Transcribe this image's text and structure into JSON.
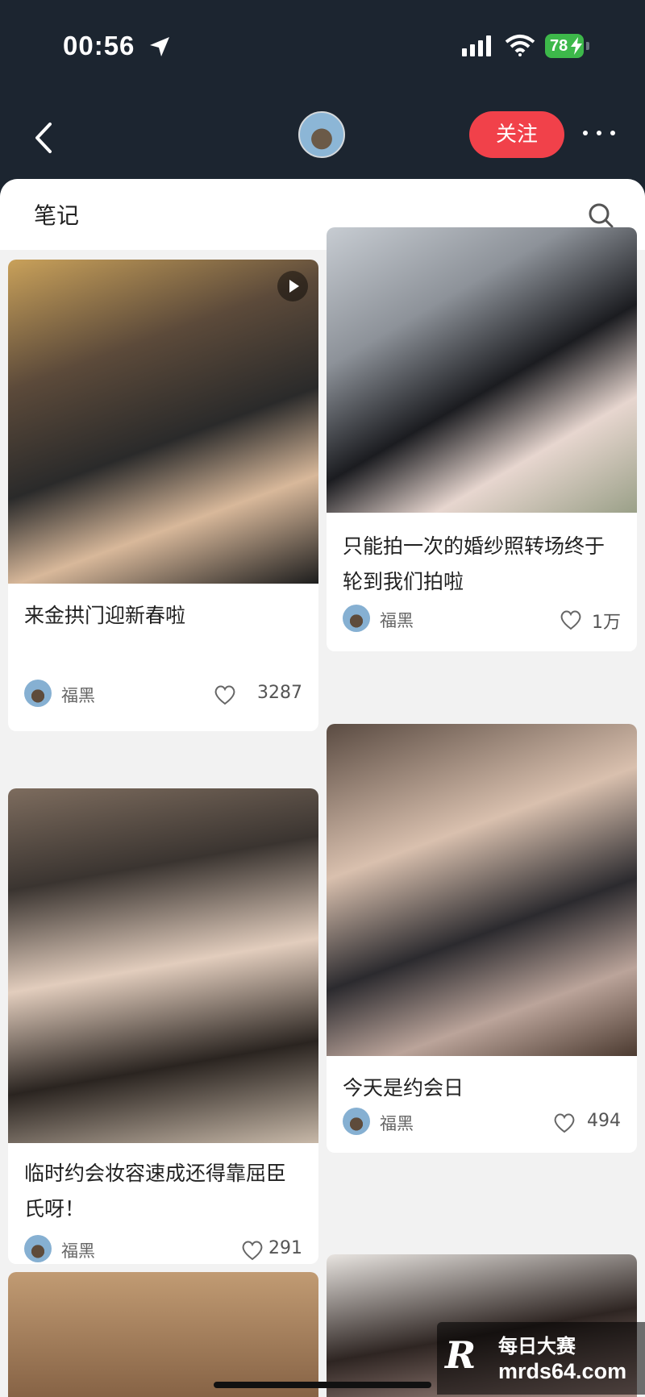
{
  "status_bar": {
    "time": "00:56",
    "battery": "78"
  },
  "nav": {
    "follow_label": "关注"
  },
  "section": {
    "title": "笔记"
  },
  "notes": [
    {
      "title": "来金拱门迎新春啦",
      "author": "福黑",
      "likes": "3287",
      "is_video": true
    },
    {
      "title": "只能拍一次的婚纱照转场终于轮到我们拍啦",
      "author": "福黑",
      "likes": "1万",
      "is_video": false
    },
    {
      "title": "今天是约会日",
      "author": "福黑",
      "likes": "494",
      "is_video": false
    },
    {
      "title": "临时约会妆容速成还得靠屈臣氏呀！",
      "author": "福黑",
      "likes": "291",
      "is_video": false
    }
  ],
  "watermark": {
    "name": "每日大赛",
    "site": "mrds64.com",
    "logo": "R"
  }
}
